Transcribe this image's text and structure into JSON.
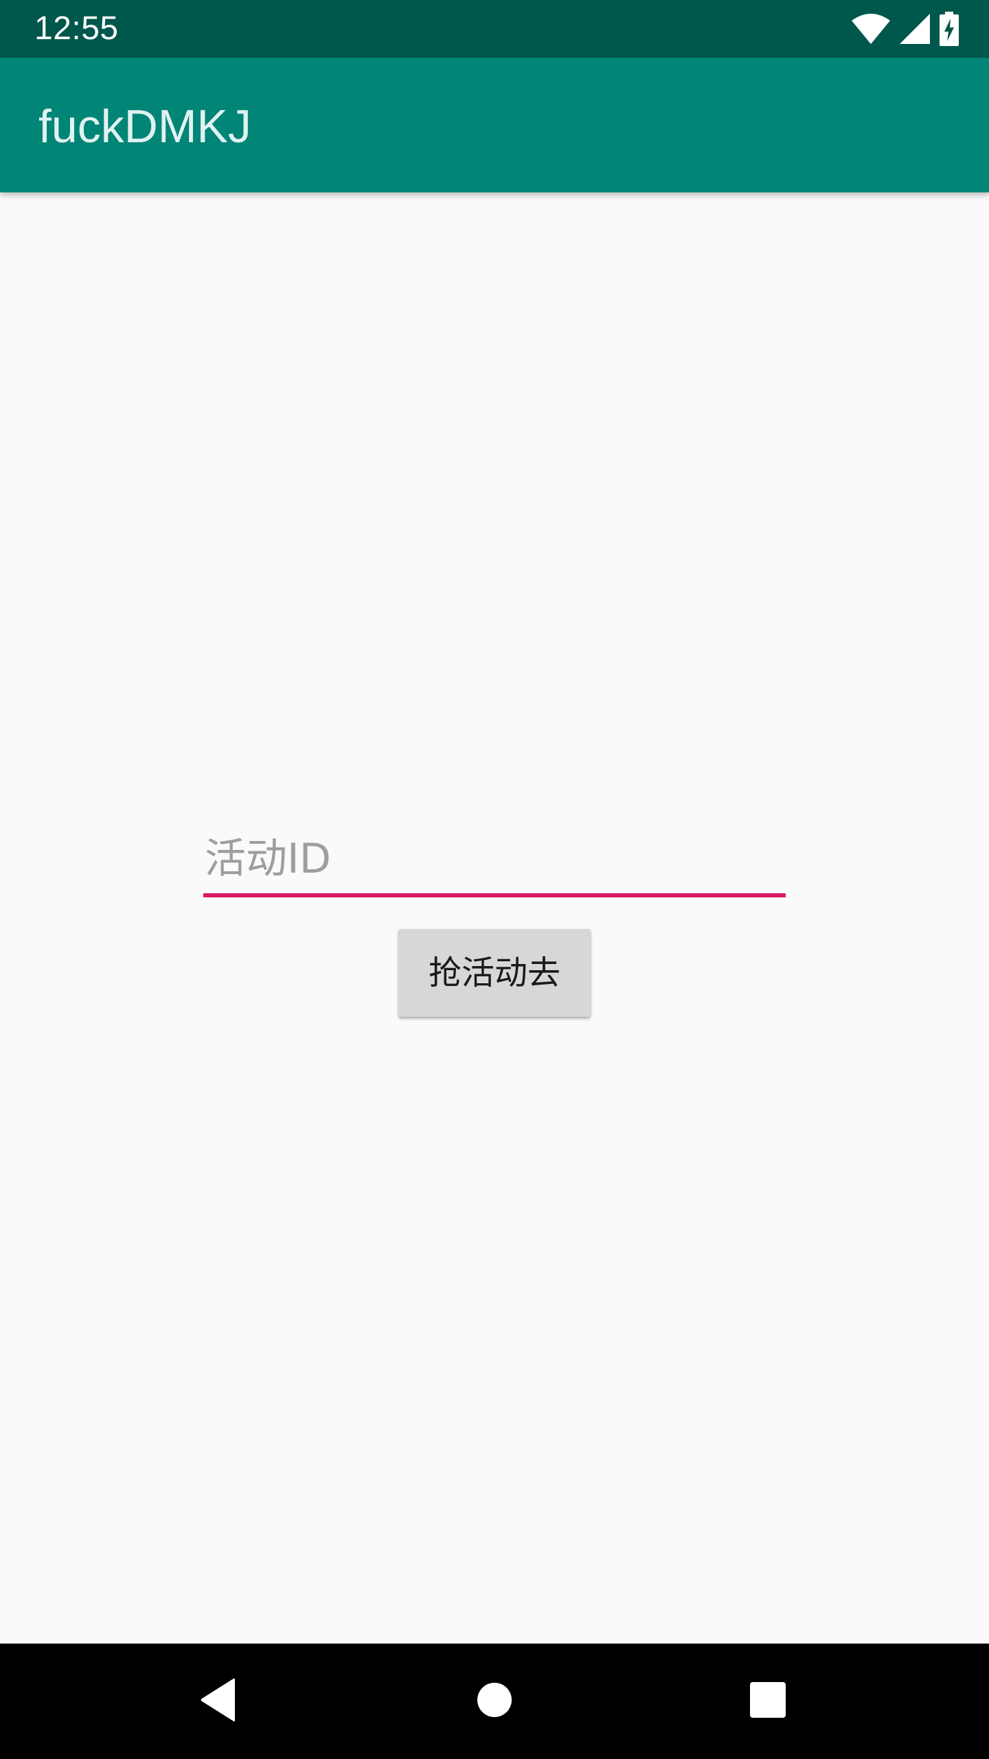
{
  "status_bar": {
    "time": "12:55",
    "icons": [
      "wifi-icon",
      "cellular-signal-icon",
      "battery-charging-icon"
    ],
    "background_color": "#00574b"
  },
  "app_bar": {
    "title": "fuckDMKJ",
    "background_color": "#008577"
  },
  "form": {
    "activity_id_placeholder": "活动ID",
    "activity_id_value": "",
    "underline_color": "#d81b60",
    "submit_label": "抢活动去"
  },
  "nav_bar": {
    "buttons": [
      "back-icon",
      "home-icon",
      "recents-icon"
    ]
  }
}
